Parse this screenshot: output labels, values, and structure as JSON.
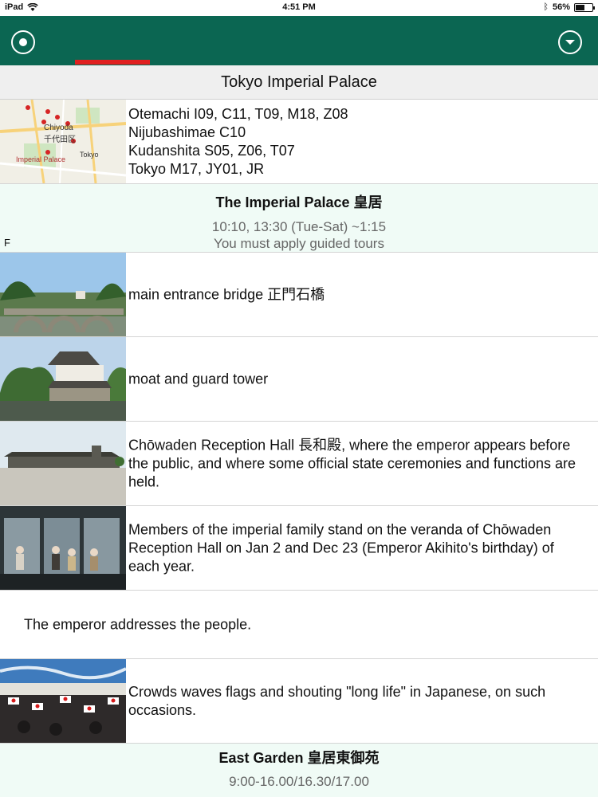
{
  "status_bar": {
    "device": "iPad",
    "time": "4:51 PM",
    "battery": "56%",
    "battery_level": 0.56
  },
  "header": {
    "title": "Tokyo Imperial Palace"
  },
  "map_row": {
    "map_labels": {
      "district": "Chiyoda",
      "district_jp": "千代田区",
      "place": "Imperial Palace",
      "other": "Tokyo"
    },
    "stations": [
      "Otemachi I09, C11, T09, M18, Z08",
      "Nijubashimae C10",
      "Kudanshita S05, Z06, T07",
      "Tokyo M17, JY01, JR"
    ]
  },
  "section1": {
    "title": "The Imperial Palace 皇居",
    "hours": "10:10, 13:30 (Tue-Sat) ~1:15",
    "note": "You must apply guided tours",
    "side_letter": "F"
  },
  "items": [
    {
      "text": "main entrance bridge 正門石橋"
    },
    {
      "text": "moat and guard tower"
    },
    {
      "text": "Chōwaden Reception Hall 長和殿, where the emperor appears before the public, and where some official state ceremonies and functions are held."
    },
    {
      "text": "Members of the imperial family stand on the veranda of Chōwaden Reception Hall on Jan 2 and Dec 23 (Emperor Akihito's birthday) of each year."
    },
    {
      "text": "The emperor addresses the people."
    },
    {
      "text": "Crowds waves flags and shouting \"long life\" in Japanese, on such occasions."
    }
  ],
  "section2": {
    "title": "East Garden 皇居東御苑",
    "hours": "9:00-16.00/16.30/17.00"
  },
  "colors": {
    "nav_green": "#0b6652",
    "indicator_red": "#e02020",
    "section_bg": "#f0fbf6"
  }
}
